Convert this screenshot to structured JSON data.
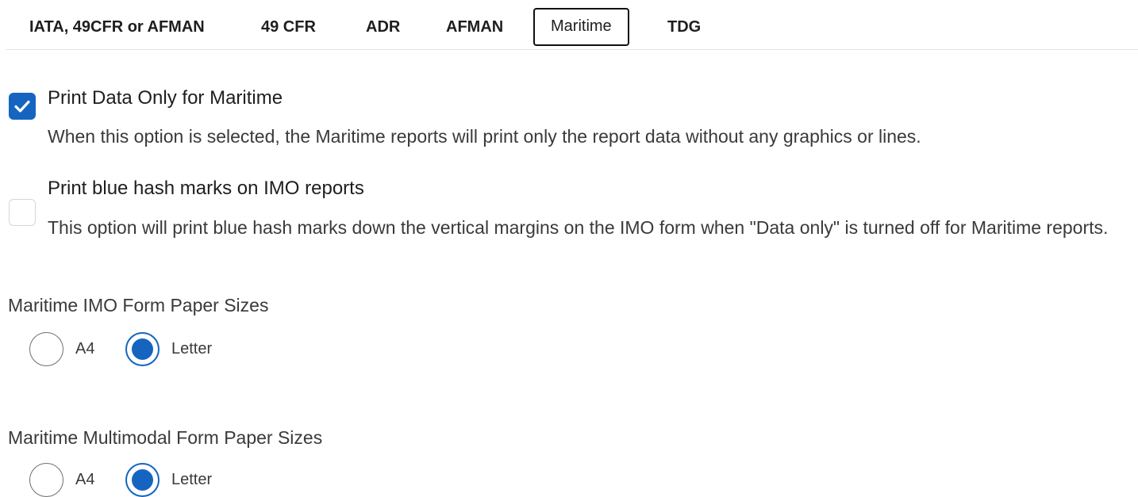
{
  "tabs": [
    {
      "label": "IATA, 49CFR or AFMAN"
    },
    {
      "label": "49 CFR"
    },
    {
      "label": "ADR"
    },
    {
      "label": "AFMAN"
    },
    {
      "label": "Maritime"
    },
    {
      "label": "TDG"
    }
  ],
  "active_tab": "Maritime",
  "options": [
    {
      "title": "Print Data Only for Maritime",
      "description": "When this option is selected, the Maritime reports will print only the report data without any graphics or lines.",
      "checked": true
    },
    {
      "title": "Print blue hash marks on IMO reports",
      "description": "This option will print blue hash marks down the vertical margins on the IMO form when \"Data only\" is turned off for Maritime reports.",
      "checked": false
    }
  ],
  "paper_groups": [
    {
      "label": "Maritime IMO Form Paper Sizes",
      "choices": [
        "A4",
        "Letter"
      ],
      "selected": "Letter"
    },
    {
      "label": "Maritime Multimodal Form Paper Sizes",
      "choices": [
        "A4",
        "Letter"
      ],
      "selected": "Letter"
    }
  ],
  "colors": {
    "accent": "#1565c0",
    "active_tab_border": "#111111"
  },
  "icons": {
    "checkbox_checked": "check-icon"
  }
}
